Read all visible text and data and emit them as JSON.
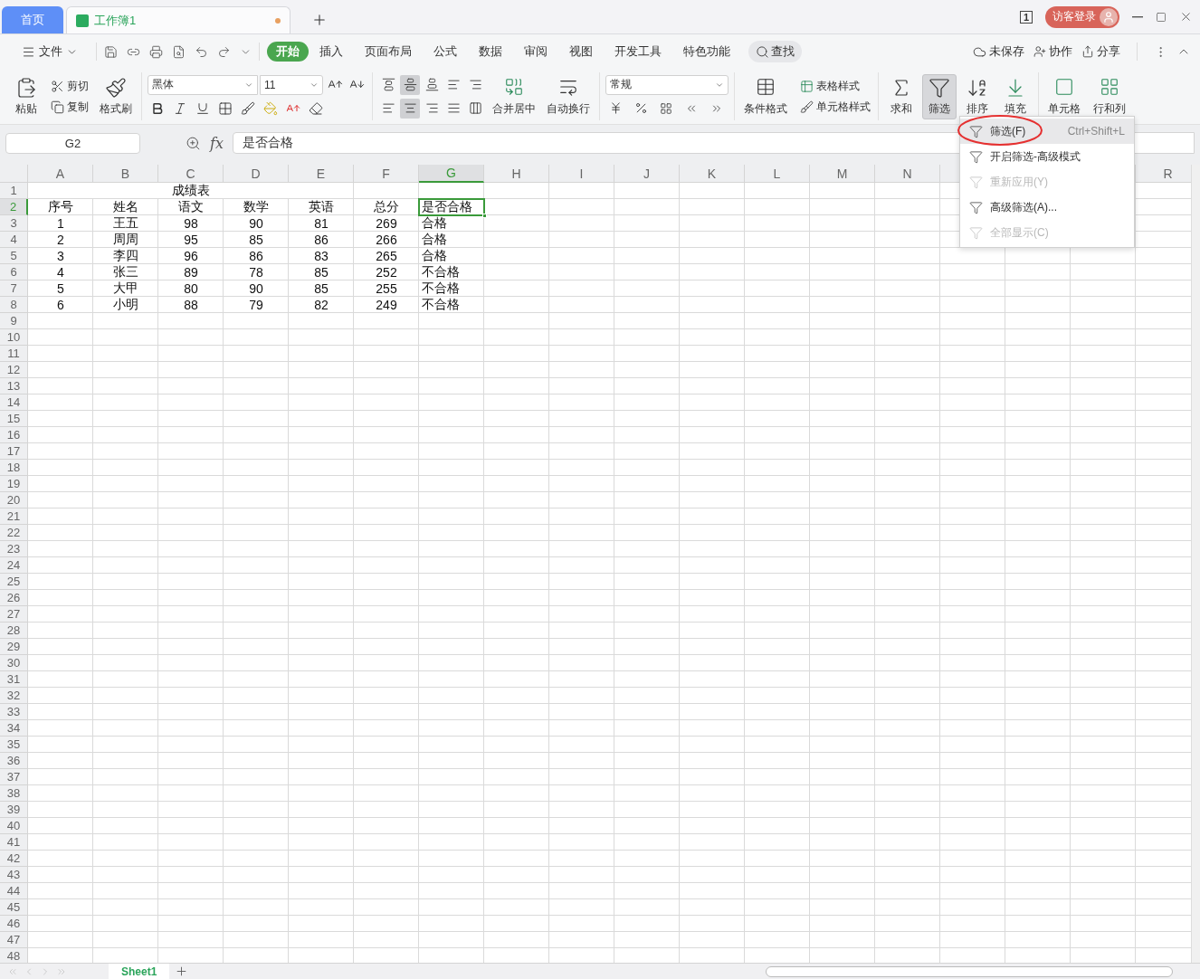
{
  "tabs": [
    {
      "label": "首页",
      "kind": "home",
      "selected": false
    },
    {
      "label": "工作簿1",
      "kind": "doc",
      "selected": true,
      "modified": true
    }
  ],
  "window": {
    "page_badge": "1",
    "login": "访客登录"
  },
  "menu": {
    "file": "文件",
    "tabs": [
      {
        "label": "开始",
        "selected": true
      },
      {
        "label": "插入",
        "selected": false
      },
      {
        "label": "页面布局",
        "selected": false
      },
      {
        "label": "公式",
        "selected": false
      },
      {
        "label": "数据",
        "selected": false
      },
      {
        "label": "审阅",
        "selected": false
      },
      {
        "label": "视图",
        "selected": false
      },
      {
        "label": "开发工具",
        "selected": false
      },
      {
        "label": "特色功能",
        "selected": false
      }
    ],
    "search": "查找",
    "unsaved": "未保存",
    "collab": "协作",
    "share": "分享"
  },
  "ribbon": {
    "paste": "粘贴",
    "cut": "剪切",
    "copy": "复制",
    "format_painter": "格式刷",
    "font_name": "黑体",
    "font_size": "11",
    "vertical_align": [
      {
        "selected": false
      },
      {
        "selected": true
      },
      {
        "selected": false
      }
    ],
    "horizontal_align": [
      {
        "selected": false
      },
      {
        "selected": true
      },
      {
        "selected": false
      },
      {
        "selected": false
      }
    ],
    "merge_center": "合并居中",
    "wrap_text": "自动换行",
    "number_format": "常规",
    "conditional_format": "条件格式",
    "table_style": "表格样式",
    "cell_style": "单元格样式",
    "sum": "求和",
    "filter": {
      "label": "筛选",
      "selected": true
    },
    "sort": "排序",
    "fill": "填充",
    "cell": "单元格",
    "rows_columns": "行和列"
  },
  "formula_bar": {
    "cell_ref": "G2",
    "fx": "fx",
    "content": "是否合格"
  },
  "sheet": {
    "columns": [
      {
        "label": "A",
        "selected": false
      },
      {
        "label": "B",
        "selected": false
      },
      {
        "label": "C",
        "selected": false
      },
      {
        "label": "D",
        "selected": false
      },
      {
        "label": "E",
        "selected": false
      },
      {
        "label": "F",
        "selected": false
      },
      {
        "label": "G",
        "selected": true
      },
      {
        "label": "H",
        "selected": false
      },
      {
        "label": "I",
        "selected": false
      },
      {
        "label": "J",
        "selected": false
      },
      {
        "label": "K",
        "selected": false
      },
      {
        "label": "L",
        "selected": false
      },
      {
        "label": "M",
        "selected": false
      },
      {
        "label": "N",
        "selected": false
      },
      {
        "label": "R",
        "selected": false
      }
    ],
    "row_headers": [
      {
        "label": "1",
        "selected": false
      },
      {
        "label": "2",
        "selected": true
      },
      {
        "label": "3",
        "selected": false
      },
      {
        "label": "4",
        "selected": false
      },
      {
        "label": "5",
        "selected": false
      },
      {
        "label": "6",
        "selected": false
      },
      {
        "label": "7",
        "selected": false
      },
      {
        "label": "8",
        "selected": false
      },
      {
        "label": "9",
        "selected": false
      },
      {
        "label": "10",
        "selected": false
      },
      {
        "label": "11",
        "selected": false
      },
      {
        "label": "12",
        "selected": false
      },
      {
        "label": "13",
        "selected": false
      },
      {
        "label": "14",
        "selected": false
      },
      {
        "label": "15",
        "selected": false
      },
      {
        "label": "16",
        "selected": false
      },
      {
        "label": "17",
        "selected": false
      },
      {
        "label": "18",
        "selected": false
      },
      {
        "label": "19",
        "selected": false
      },
      {
        "label": "20",
        "selected": false
      },
      {
        "label": "21",
        "selected": false
      },
      {
        "label": "22",
        "selected": false
      },
      {
        "label": "23",
        "selected": false
      },
      {
        "label": "24",
        "selected": false
      },
      {
        "label": "25",
        "selected": false
      },
      {
        "label": "26",
        "selected": false
      },
      {
        "label": "27",
        "selected": false
      },
      {
        "label": "28",
        "selected": false
      },
      {
        "label": "29",
        "selected": false
      },
      {
        "label": "30",
        "selected": false
      },
      {
        "label": "31",
        "selected": false
      },
      {
        "label": "32",
        "selected": false
      },
      {
        "label": "33",
        "selected": false
      },
      {
        "label": "34",
        "selected": false
      },
      {
        "label": "35",
        "selected": false
      },
      {
        "label": "36",
        "selected": false
      },
      {
        "label": "37",
        "selected": false
      },
      {
        "label": "38",
        "selected": false
      },
      {
        "label": "39",
        "selected": false
      },
      {
        "label": "40",
        "selected": false
      },
      {
        "label": "41",
        "selected": false
      },
      {
        "label": "42",
        "selected": false
      },
      {
        "label": "43",
        "selected": false
      },
      {
        "label": "44",
        "selected": false
      },
      {
        "label": "45",
        "selected": false
      },
      {
        "label": "46",
        "selected": false
      },
      {
        "label": "47",
        "selected": false
      },
      {
        "label": "48",
        "selected": false
      }
    ],
    "title": "成绩表",
    "header": [
      {
        "text": "序号",
        "selected": false
      },
      {
        "text": "姓名",
        "selected": false
      },
      {
        "text": "语文",
        "selected": false
      },
      {
        "text": "数学",
        "selected": false
      },
      {
        "text": "英语",
        "selected": false
      },
      {
        "text": "总分",
        "selected": false
      },
      {
        "text": "是否合格",
        "selected": true
      }
    ],
    "rows": [
      [
        "1",
        "王五",
        "98",
        "90",
        "81",
        "269",
        "合格"
      ],
      [
        "2",
        "周周",
        "95",
        "85",
        "86",
        "266",
        "合格"
      ],
      [
        "3",
        "李四",
        "96",
        "86",
        "83",
        "265",
        "合格"
      ],
      [
        "4",
        "张三",
        "89",
        "78",
        "85",
        "252",
        "不合格"
      ],
      [
        "5",
        "大甲",
        "80",
        "90",
        "85",
        "255",
        "不合格"
      ],
      [
        "6",
        "小明",
        "88",
        "79",
        "82",
        "249",
        "不合格"
      ]
    ]
  },
  "filter_menu": [
    {
      "label": "筛选(F)",
      "shortcut": "Ctrl+Shift+L",
      "disabled": false,
      "selected": true
    },
    {
      "label": "开启筛选-高级模式",
      "disabled": false,
      "selected": false
    },
    {
      "label": "重新应用(Y)",
      "disabled": true,
      "selected": false
    },
    {
      "label": "高级筛选(A)...",
      "disabled": false,
      "selected": false
    },
    {
      "label": "全部显示(C)",
      "disabled": true,
      "selected": false
    }
  ],
  "sheet_tabs": [
    {
      "label": "Sheet1",
      "selected": true
    }
  ]
}
